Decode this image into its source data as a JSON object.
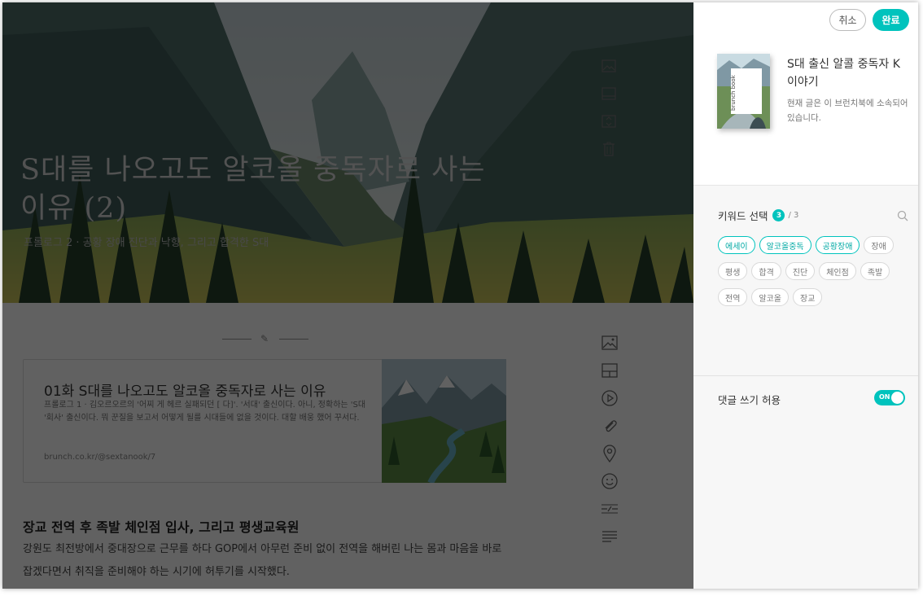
{
  "editor": {
    "cover_title": "S대를 나오고도 알코올 중독자로 사는 이유 (2)",
    "cover_subtitle": "프롤로그 2 · 공황 장애 진단과 낙향, 그리고 합격한 S대",
    "link_card": {
      "title": "01화 S대를 나오고도 알코올 중독자로 사는 이유",
      "description": "프롤로그 1 · 김오르오르의 '어찌 게 헤르 실패되던 [ 다]'. '서대' 출신이다. 아니, 정확하는 'S대 '회사' 출신이다. 뭐 꾼질을 보고서 어떻게 될를 시대들에 없을 것이다. 대할 배웅 했어 꾸서다.",
      "url": "brunch.co.kr/@sextanook/7"
    },
    "section_heading": "장교 전역 후 족발 체인점 입사, 그리고 평생교육원",
    "section_paragraph": "강원도 최전방에서 중대장으로 근무를 하다 GOP에서 아무런 준비 없이 전역을 해버린 나는 몸과 마음을 바로 잡겠다면서 취직을 준비해야 하는 시기에 허투기를 시작했다."
  },
  "panel": {
    "cancel_label": "취소",
    "done_label": "완료",
    "book": {
      "spine_text": "brunch book",
      "title": "S대 출신 알콜 중독자 K 이야기",
      "description": "현재 글은 이 브런치북에 소속되어 있습니다."
    },
    "keywords": {
      "heading": "키워드 선택",
      "selected_count": "3",
      "max": "/ 3",
      "items": [
        {
          "label": "에세이",
          "selected": true
        },
        {
          "label": "알코올중독",
          "selected": true
        },
        {
          "label": "공황장애",
          "selected": true
        },
        {
          "label": "장애",
          "selected": false
        },
        {
          "label": "평생",
          "selected": false
        },
        {
          "label": "합격",
          "selected": false
        },
        {
          "label": "진단",
          "selected": false
        },
        {
          "label": "체인점",
          "selected": false
        },
        {
          "label": "족발",
          "selected": false
        },
        {
          "label": "전역",
          "selected": false
        },
        {
          "label": "알코올",
          "selected": false
        },
        {
          "label": "장교",
          "selected": false
        }
      ]
    },
    "comment": {
      "label": "댓글 쓰기 허용",
      "toggle_text": "ON",
      "enabled": true
    }
  },
  "colors": {
    "accent": "#00c3bd",
    "dim_overlay": "rgba(0,0,0,0.62)"
  },
  "icons": {
    "cover_tools": [
      "image-icon",
      "cover-layout-icon",
      "cover-height-icon",
      "trash-icon"
    ],
    "side_tools": [
      "image-icon",
      "layout-icon",
      "video-icon",
      "attachment-icon",
      "location-icon",
      "emoticon-icon",
      "divider-icon",
      "text-align-icon"
    ]
  }
}
